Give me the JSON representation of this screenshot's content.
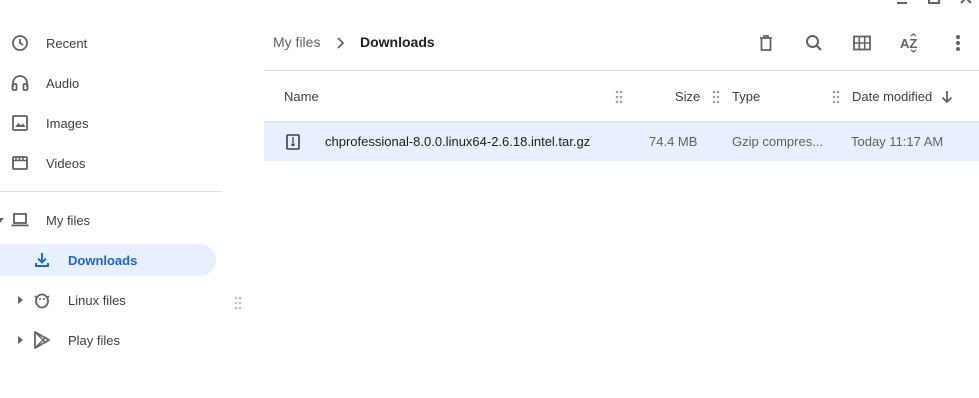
{
  "sidebar": {
    "items": [
      {
        "label": "Recent",
        "icon": "clock-icon"
      },
      {
        "label": "Audio",
        "icon": "headphones-icon"
      },
      {
        "label": "Images",
        "icon": "image-icon"
      },
      {
        "label": "Videos",
        "icon": "film-icon"
      }
    ],
    "my_files": {
      "label": "My files",
      "icon": "laptop-icon"
    },
    "downloads": {
      "label": "Downloads",
      "icon": "download-icon"
    },
    "linux_files": {
      "label": "Linux files",
      "icon": "penguin-icon"
    },
    "play_files": {
      "label": "Play files",
      "icon": "play-store-icon"
    }
  },
  "breadcrumb": {
    "root": "My files",
    "current": "Downloads"
  },
  "toolbar": {
    "delete_icon": "trash-icon",
    "search_icon": "search-icon",
    "view_icon": "grid-view-icon",
    "sort_icon": "sort-az-icon",
    "more_icon": "more-vert-icon"
  },
  "columns": {
    "name": "Name",
    "size": "Size",
    "type": "Type",
    "date": "Date modified",
    "sort": "descending"
  },
  "files": [
    {
      "name": "chprofessional-8.0.0.linux64-2.6.18.intel.tar.gz",
      "size": "74.4 MB",
      "type": "Gzip compres...",
      "date": "Today 11:17 AM",
      "icon": "archive-file-icon",
      "selected": true
    }
  ],
  "colors": {
    "selection": "#e8f0fe",
    "accent": "#1967d2",
    "text": "#3c4043"
  }
}
